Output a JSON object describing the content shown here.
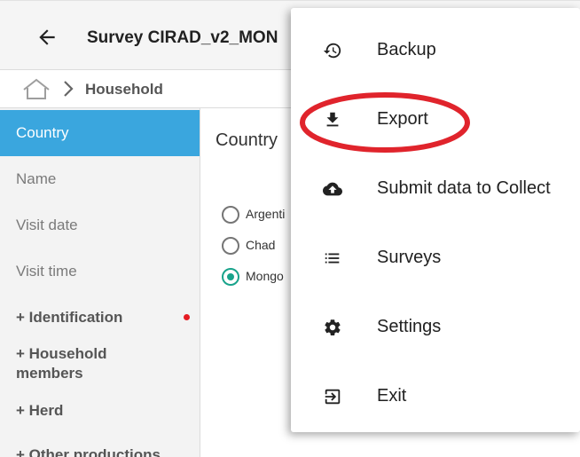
{
  "app_bar": {
    "title": "Survey CIRAD_v2_MON",
    "back_icon": "arrow-left-icon"
  },
  "breadcrumb": {
    "home_icon": "home-icon",
    "separator_icon": "chevron-right-icon",
    "current": "Household"
  },
  "sidebar": {
    "items": [
      {
        "label": "Country",
        "active": true
      },
      {
        "label": "Name"
      },
      {
        "label": "Visit date"
      },
      {
        "label": "Visit time"
      },
      {
        "label": "+ Identification",
        "has_error": true
      },
      {
        "label": "+ Household members"
      },
      {
        "label": "+ Herd"
      },
      {
        "label": "+ Other productions"
      }
    ]
  },
  "content": {
    "title": "Country",
    "options": [
      {
        "label": "Argenti",
        "checked": false
      },
      {
        "label": "Chad",
        "checked": false
      },
      {
        "label": "Mongo",
        "checked": true
      }
    ]
  },
  "menu": {
    "items": [
      {
        "label": "Backup",
        "icon": "restore-icon"
      },
      {
        "label": "Export",
        "icon": "download-icon"
      },
      {
        "label": "Submit data to Collect",
        "icon": "cloud-upload-icon"
      },
      {
        "label": "Surveys",
        "icon": "list-icon"
      },
      {
        "label": "Settings",
        "icon": "gear-icon"
      },
      {
        "label": "Exit",
        "icon": "exit-icon"
      }
    ]
  },
  "colors": {
    "accent": "#3aa6de",
    "radio_checked": "#18a38b",
    "annotation": "#e0242c",
    "error_dot": "#e51c23"
  }
}
